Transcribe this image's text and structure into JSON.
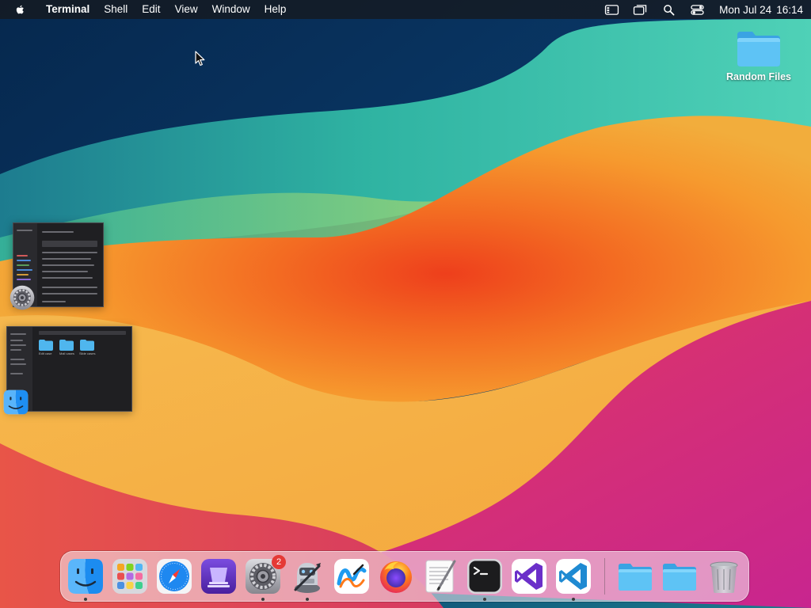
{
  "menubar": {
    "app_name": "Terminal",
    "menus": [
      "Shell",
      "Edit",
      "View",
      "Window",
      "Help"
    ],
    "clock": {
      "date": "Mon Jul 24",
      "time": "16:14"
    }
  },
  "desktop": {
    "icons": [
      {
        "label": "Random Files",
        "type": "folder"
      }
    ],
    "minimized_windows": [
      {
        "app": "System Settings"
      },
      {
        "app": "Finder",
        "folder_labels": [
          "Edit case",
          "Mail cases",
          "Slide cases"
        ]
      }
    ]
  },
  "dock": {
    "apps": [
      {
        "name": "Finder",
        "icon": "finder-icon",
        "running": true
      },
      {
        "name": "Launchpad",
        "icon": "launchpad-icon",
        "running": false
      },
      {
        "name": "Safari",
        "icon": "safari-icon",
        "running": false
      },
      {
        "name": "Simulator",
        "icon": "simulator-icon",
        "running": false
      },
      {
        "name": "System Settings",
        "icon": "system-settings-icon",
        "running": true,
        "badge": "2"
      },
      {
        "name": "Automator",
        "icon": "automator-icon",
        "running": true
      },
      {
        "name": "Freeform",
        "icon": "freeform-icon",
        "running": false
      },
      {
        "name": "Firefox",
        "icon": "firefox-icon",
        "running": false
      },
      {
        "name": "TextEdit",
        "icon": "textedit-icon",
        "running": false
      },
      {
        "name": "Terminal",
        "icon": "terminal-icon",
        "running": true
      },
      {
        "name": "Visual Studio",
        "icon": "visual-studio-icon",
        "running": false
      },
      {
        "name": "Visual Studio Code",
        "icon": "vscode-icon",
        "running": true
      }
    ],
    "folders": [
      {
        "name": "Folder",
        "icon": "folder-icon"
      },
      {
        "name": "Folder",
        "icon": "folder-icon"
      }
    ],
    "trash": {
      "name": "Trash",
      "icon": "trash-icon"
    }
  }
}
